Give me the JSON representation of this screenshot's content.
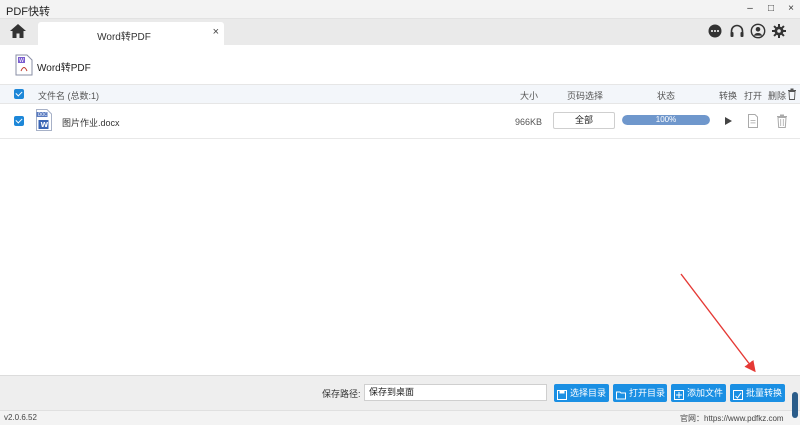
{
  "window": {
    "title": "PDF快转",
    "minimize": "–",
    "maximize": "□",
    "close": "×"
  },
  "tabs": [
    {
      "label": "Word转PDF",
      "close": "×"
    }
  ],
  "topbar_icons": [
    "chat-icon",
    "headset-icon",
    "user-icon",
    "gear-icon"
  ],
  "subheader": {
    "title": "Word转PDF"
  },
  "table": {
    "headers": {
      "filename": "文件名 (总数:1)",
      "size": "大小",
      "page_select": "页码选择",
      "status": "状态",
      "convert": "转换",
      "open": "打开",
      "delete": "删除"
    },
    "rows": [
      {
        "filename": "图片作业.docx",
        "size": "966KB",
        "range": "全部",
        "progress_label": "100%",
        "progress": 100
      }
    ]
  },
  "bottom": {
    "save_label": "保存路径:",
    "save_value": "保存到桌面",
    "buttons": {
      "choose_dir": "选择目录",
      "open_dir": "打开目录",
      "add_file": "添加文件",
      "batch_convert": "批量转换"
    }
  },
  "status": {
    "version": "v2.0.6.52",
    "site": "官网：https://www.pdfkz.com"
  },
  "colors": {
    "accent": "#1a8fe3",
    "progress_fill": "#6f97cc",
    "arrow": "#e53935"
  }
}
